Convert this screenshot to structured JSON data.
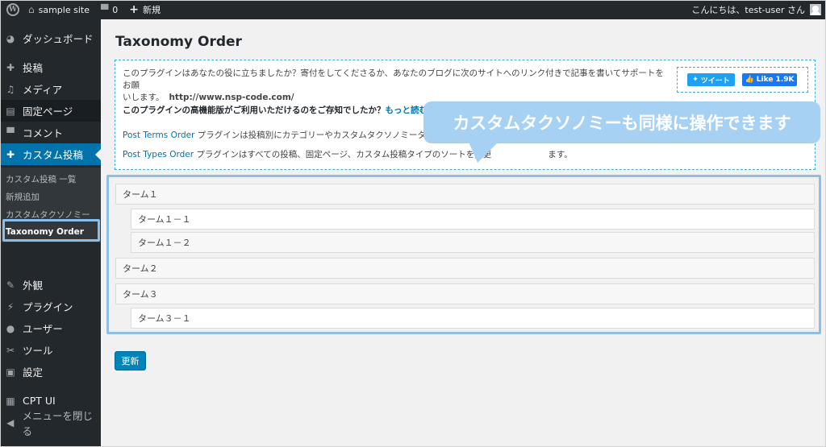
{
  "admin_bar": {
    "site_name": "sample site",
    "comments_count": "0",
    "new_label": "新規",
    "greeting": "こんにちは、test-user さん"
  },
  "sidebar": {
    "items": [
      {
        "label": "ダッシュボード",
        "icon": "dashboard-icon"
      },
      {
        "label": "投稿",
        "icon": "pin-icon"
      },
      {
        "label": "メディア",
        "icon": "media-icon"
      },
      {
        "label": "固定ページ",
        "icon": "page-icon"
      },
      {
        "label": "コメント",
        "icon": "comment-icon"
      },
      {
        "label": "カスタム投稿",
        "icon": "pin-icon"
      }
    ],
    "submenu": [
      "カスタム投稿 一覧",
      "新規追加",
      "カスタムタクソノミー",
      "Taxonomy Order"
    ],
    "items2": [
      {
        "label": "外観",
        "icon": "appearance-icon"
      },
      {
        "label": "プラグイン",
        "icon": "plugin-icon"
      },
      {
        "label": "ユーザー",
        "icon": "user-icon"
      },
      {
        "label": "ツール",
        "icon": "wrench-icon"
      },
      {
        "label": "設定",
        "icon": "settings-icon"
      },
      {
        "label": "CPT UI",
        "icon": "cpt-icon"
      },
      {
        "label": "メニューを閉じる",
        "icon": "collapse-icon"
      }
    ]
  },
  "page": {
    "title": "Taxonomy Order",
    "notice": {
      "line1": "このプラグインはあなたの役に立ちましたか？寄付をしてくださるか、あなたのブログに次のサイトへのリンク付きで記事を書いてサポートをお願",
      "line2": "いします。",
      "url": "http://www.nsp-code.com/",
      "pro_question": "このプラグインの高機能版がご利用いただけるのをご存知でしたか？",
      "read_more": "もっと読む",
      "post_terms_link": "Post Terms Order",
      "post_terms_text": " プラグインは投稿別にカテゴリーやカスタムタクソノミーター",
      "post_types_link": "Post Types Order",
      "post_types_text": " プラグインはすべての投稿、固定ページ、カスタム投稿タイプのソートを変更",
      "post_types_tail": "ます。",
      "tweet_label": "ツイート",
      "like_label": "Like 1.9K"
    },
    "callout": "カスタムタクソノミーも同様に操作できます",
    "terms": [
      "ターム１",
      "ターム１－１",
      "ターム１－２",
      "ターム２",
      "ターム３",
      "ターム３－１"
    ],
    "update_button": "更新"
  },
  "colors": {
    "accent": "#0073aa",
    "callout": "#a6d1f2",
    "highlight_border": "#8bbfe8"
  }
}
